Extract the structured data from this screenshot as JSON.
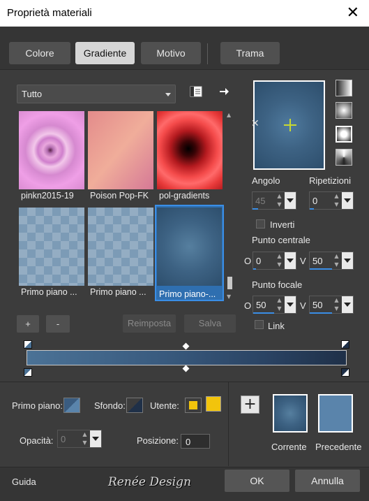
{
  "window": {
    "title": "Proprietà materiali",
    "close_glyph": "✕"
  },
  "tabs": [
    {
      "label": "Colore"
    },
    {
      "label": "Gradiente",
      "active": true
    },
    {
      "label": "Motivo"
    },
    {
      "label": "Trama"
    }
  ],
  "category": {
    "selected": "Tutto"
  },
  "gradients": [
    {
      "label": "pinkn2015-19"
    },
    {
      "label": "Poison Pop-FK"
    },
    {
      "label": "pol-gradients"
    },
    {
      "label": "Primo piano ..."
    },
    {
      "label": "Primo piano ..."
    },
    {
      "label": "Primo piano-...",
      "selected": true
    }
  ],
  "list_buttons": {
    "add": "+",
    "remove": "-",
    "reset": "Reimposta",
    "save": "Salva"
  },
  "angle": {
    "label": "Angolo",
    "value": "45"
  },
  "repeats": {
    "label": "Ripetizioni",
    "value": "0"
  },
  "invert": {
    "label": "Inverti",
    "checked": false
  },
  "center": {
    "label": "Punto centrale",
    "h_label": "O",
    "h_value": "0",
    "v_label": "V",
    "v_value": "50"
  },
  "focal": {
    "label": "Punto focale",
    "h_label": "O",
    "h_value": "50",
    "v_label": "V",
    "v_value": "50"
  },
  "link": {
    "label": "Link",
    "checked": false
  },
  "bottom": {
    "foreground_label": "Primo piano:",
    "background_label": "Sfondo:",
    "user_label": "Utente:",
    "opacity_label": "Opacità:",
    "opacity_value": "0",
    "position_label": "Posizione:",
    "position_value": "0",
    "add_glyph": "+",
    "current_label": "Corrente",
    "previous_label": "Precedente",
    "user_color": "#f2c40c"
  },
  "footer": {
    "help": "Guida",
    "watermark": "Renée Design",
    "ok": "OK",
    "cancel": "Annulla"
  },
  "colors": {
    "accent": "#3a8ee6",
    "gradient_start": "#4b7296",
    "gradient_end": "#1f3048",
    "previous_swatch": "#5a84ab"
  }
}
